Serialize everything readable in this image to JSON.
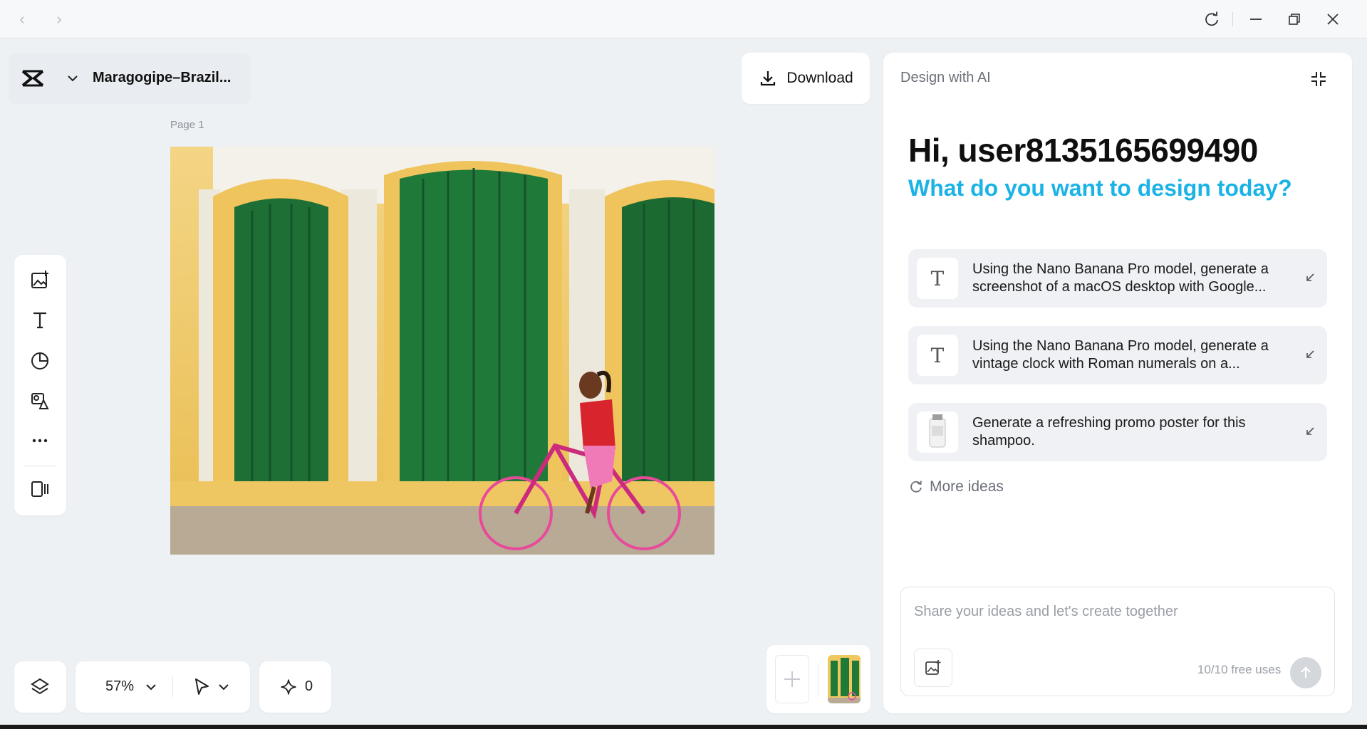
{
  "titlebar": {
    "back": "‹",
    "forward": "›"
  },
  "document": {
    "filename": "Maragogipe–Brazil...",
    "page_label": "Page 1"
  },
  "header": {
    "download_label": "Download"
  },
  "toolbar": {
    "tools": [
      "add-image",
      "text",
      "shapes",
      "elements",
      "more",
      "panels"
    ]
  },
  "bottom": {
    "zoom": "57%",
    "credits": "0"
  },
  "ai_panel": {
    "title": "Design with AI",
    "greeting": "Hi, user8135165699490",
    "subgreeting": "What do you want to design today?",
    "ideas": [
      {
        "icon": "T",
        "text": "Using the Nano Banana Pro model, generate a screenshot of a macOS desktop with Google..."
      },
      {
        "icon": "T",
        "text": "Using the Nano Banana Pro model, generate a vintage clock with Roman numerals on a..."
      },
      {
        "icon": "shampoo-thumbnail",
        "text": "Generate a refreshing promo poster for this shampoo."
      }
    ],
    "more_ideas": "More ideas",
    "prompt_placeholder": "Share your ideas and let's create together",
    "free_uses": "10/10 free uses"
  },
  "colors": {
    "accent": "#1bb3e6",
    "canvas_bg": "#eef1f4",
    "door_green": "#1f7a3a",
    "wall_yellow": "#f0c860"
  }
}
